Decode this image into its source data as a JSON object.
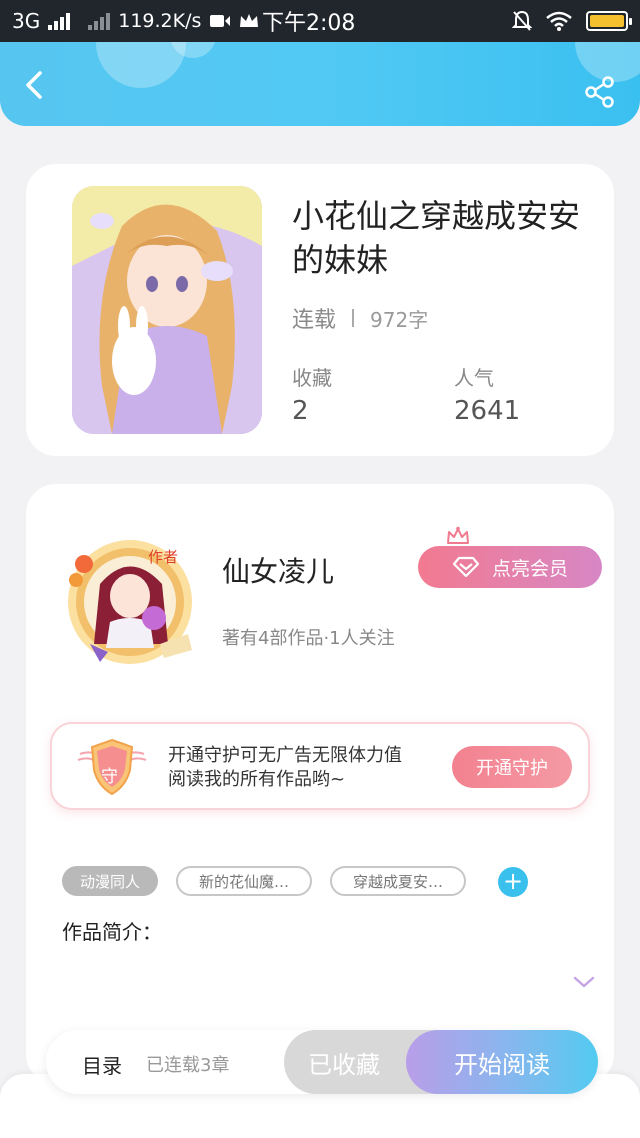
{
  "status_bar": {
    "network": "3G",
    "speed": "119.2K/s",
    "time": "下午2:08"
  },
  "book": {
    "title": "小花仙之穿越成安安的妹妹",
    "status": "连载",
    "word_count": "972字",
    "favorites_label": "收藏",
    "favorites_value": "2",
    "popularity_label": "人气",
    "popularity_value": "2641"
  },
  "author": {
    "badge": "作者",
    "name": "仙女凌儿",
    "info": "著有4部作品·1人关注",
    "vip_button": "点亮会员"
  },
  "guard": {
    "icon_char": "守",
    "text_line1": "开通守护可无广告无限体力值",
    "text_line2": "阅读我的所有作品哟~",
    "button": "开通守护"
  },
  "tags": [
    "动漫同人",
    "新的花仙魔…",
    "穿越成夏安…"
  ],
  "tag_add": "+",
  "intro_label": "作品简介：",
  "bottom": {
    "toc": "目录",
    "chapters": "已连载3章",
    "collected": "已收藏",
    "start_reading": "开始阅读"
  },
  "colors": {
    "header": "#52c9f4",
    "accent_pink": "#f27a90",
    "accent_blue": "#39c0ec"
  },
  "icons": [
    "back-arrow-icon",
    "share-icon",
    "crown-icon",
    "diamond-icon",
    "shield-icon",
    "plus-icon",
    "chevron-down-icon"
  ]
}
